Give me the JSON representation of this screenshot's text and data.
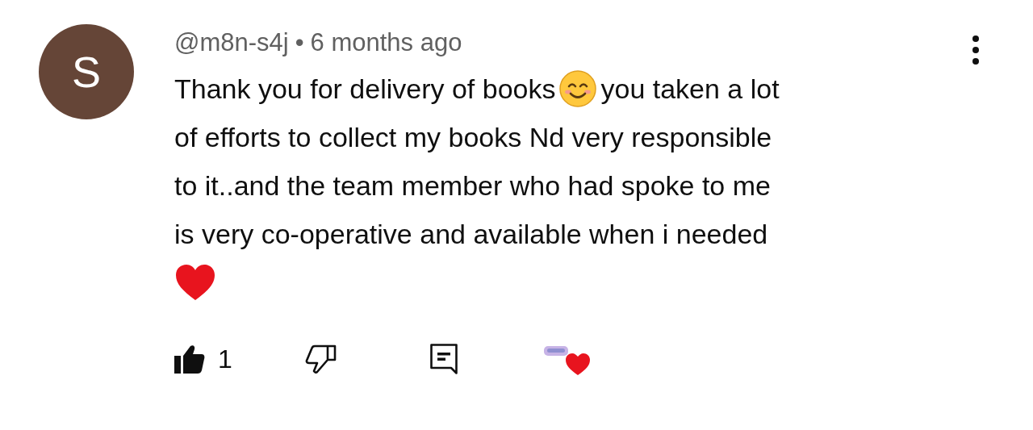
{
  "comment": {
    "avatar_letter": "S",
    "author": "@m8n-s4j",
    "separator": "•",
    "time": "6 months ago",
    "lines": [
      [
        {
          "kind": "text",
          "text": "Thank you for delivery of books"
        },
        {
          "kind": "smile-emoji"
        },
        {
          "kind": "text",
          "text": "you taken a lot"
        }
      ],
      [
        {
          "kind": "text",
          "text": "of efforts to collect my books Nd very responsible"
        }
      ],
      [
        {
          "kind": "text",
          "text": "to it..and the team member who had spoke to me"
        }
      ],
      [
        {
          "kind": "text",
          "text": "is very co-operative and available when i needed"
        }
      ],
      [
        {
          "kind": "heart-emoji"
        }
      ]
    ],
    "likes": "1",
    "creator_heart": true
  }
}
